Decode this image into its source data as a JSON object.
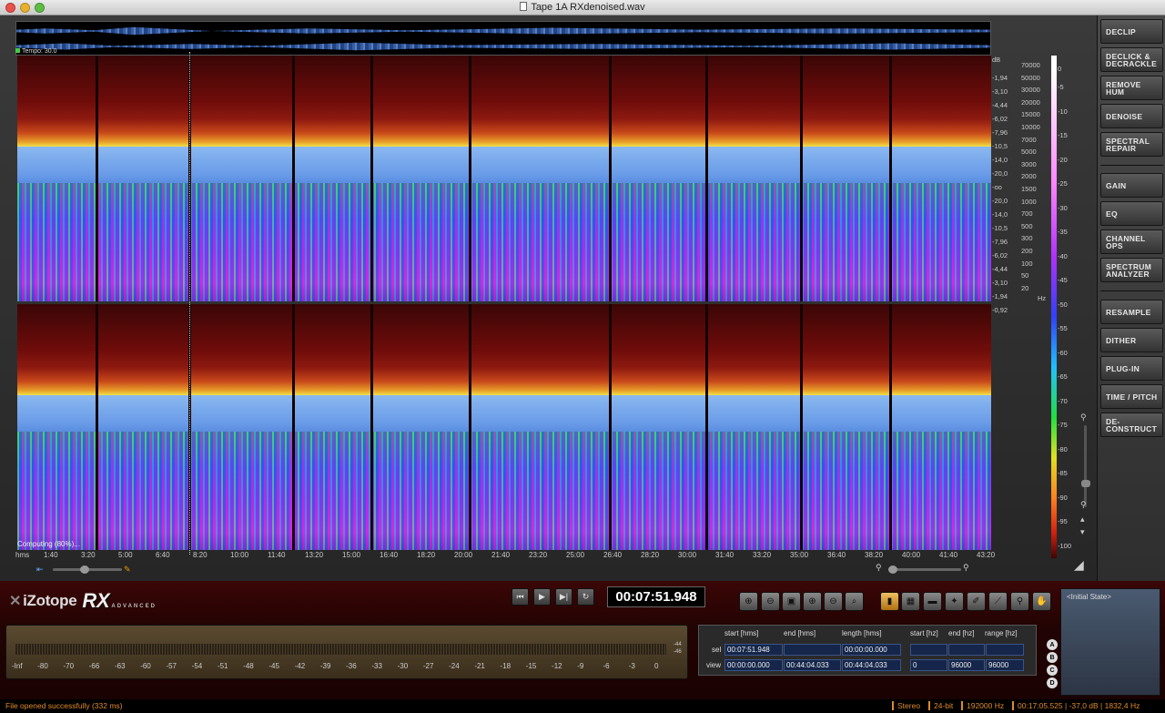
{
  "window": {
    "title": "Tape 1A RXdenoised.wav"
  },
  "tempo": "Tempo: 30.0",
  "computing": "Computing (80%)...",
  "db_unit": "dB",
  "hz_unit": "Hz",
  "db_scale": [
    "-1,94",
    "-3,10",
    "-4,44",
    "-6,02",
    "-7,96",
    "-10,5",
    "-14,0",
    "-20,0",
    "-oo",
    "-20,0",
    "-14,0",
    "-10,5",
    "-7,96",
    "-6,02",
    "-4,44",
    "-3,10",
    "-1,94",
    "-0,92"
  ],
  "hz_scale": [
    "70000",
    "50000",
    "30000",
    "20000",
    "15000",
    "10000",
    "7000",
    "5000",
    "3000",
    "2000",
    "1500",
    "1000",
    "700",
    "500",
    "300",
    "200",
    "100",
    "50",
    "20"
  ],
  "color_scale": [
    "-5",
    "-10",
    "-15",
    "-20",
    "-25",
    "-30",
    "-35",
    "-40",
    "-45",
    "-50",
    "-55",
    "-60",
    "-65",
    "-70",
    "-75",
    "-80",
    "-85",
    "-90",
    "-95",
    "-100"
  ],
  "color_scale_top": "0",
  "time_axis": {
    "unit": "hms",
    "ticks": [
      "1:40",
      "3:20",
      "5:00",
      "6:40",
      "8:20",
      "10:00",
      "11:40",
      "13:20",
      "15:00",
      "16:40",
      "18:20",
      "20:00",
      "21:40",
      "23:20",
      "25:00",
      "26:40",
      "28:20",
      "30:00",
      "31:40",
      "33:20",
      "35:00",
      "36:40",
      "38:20",
      "40:00",
      "41:40",
      "43:20"
    ]
  },
  "modules": [
    "DECLIP",
    "DECLICK & DECRACKLE",
    "REMOVE HUM",
    "DENOISE",
    "SPECTRAL REPAIR",
    "GAIN",
    "EQ",
    "CHANNEL OPS",
    "SPECTRUM ANALYZER",
    "RESAMPLE",
    "DITHER",
    "PLUG-IN",
    "TIME / PITCH",
    "DE-CONSTRUCT"
  ],
  "logo": {
    "brand": "iZotope",
    "product": "RX",
    "edition": "ADVANCED"
  },
  "transport": {
    "timecode": "00:07:51.948"
  },
  "history": {
    "title": "<Initial State>"
  },
  "meter": {
    "labels": [
      "-Inf",
      "-80",
      "-70",
      "-66",
      "-63",
      "-60",
      "-57",
      "-54",
      "-51",
      "-48",
      "-45",
      "-42",
      "-39",
      "-36",
      "-33",
      "-30",
      "-27",
      "-24",
      "-21",
      "-18",
      "-15",
      "-12",
      "-9",
      "-6",
      "-3",
      "0"
    ],
    "side_top": "-44",
    "side_bottom": "-46"
  },
  "selection": {
    "headers": [
      "start [hms]",
      "end [hms]",
      "length [hms]",
      "start [hz]",
      "end [hz]",
      "range [hz]"
    ],
    "sel_label": "sel",
    "view_label": "view",
    "sel": {
      "start": "00:07:51.948",
      "end": "",
      "length": "00:00:00.000",
      "start_hz": "",
      "end_hz": "",
      "range_hz": ""
    },
    "view": {
      "start": "00:00:00.000",
      "end": "00:44:04.033",
      "length": "00:44:04.033",
      "start_hz": "0",
      "end_hz": "96000",
      "range_hz": "96000"
    }
  },
  "abcd": [
    "A",
    "B",
    "C",
    "D"
  ],
  "status": {
    "message": "File opened successfully (332 ms)",
    "channels": "Stereo",
    "bitdepth": "24-bit",
    "samplerate": "192000 Hz",
    "cursor": "00:17:05.525 | -37,0 dB | 1832,4 Hz"
  }
}
